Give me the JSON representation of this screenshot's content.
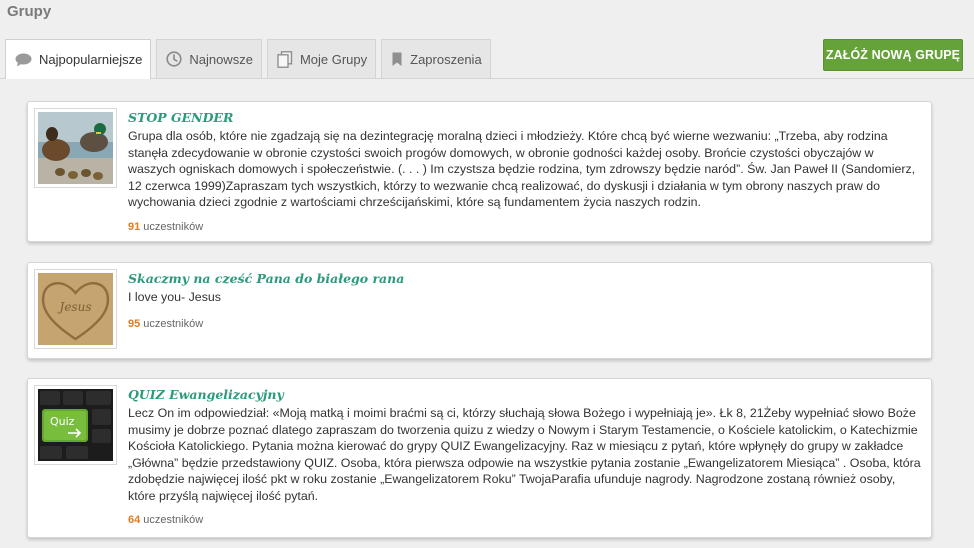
{
  "page": {
    "title": "Grupy"
  },
  "tabs": [
    {
      "label": "Najpopularniejsze",
      "icon": "speech-bubble-icon",
      "active": true
    },
    {
      "label": "Najnowsze",
      "icon": "clock-icon",
      "active": false
    },
    {
      "label": "Moje Grupy",
      "icon": "documents-icon",
      "active": false
    },
    {
      "label": "Zaproszenia",
      "icon": "bookmark-icon",
      "active": false
    }
  ],
  "create_button": {
    "label": "ZAŁÓŻ NOWĄ GRUPĘ"
  },
  "colors": {
    "accent_green": "#66a23a",
    "title_teal": "#2a9a7c",
    "count_orange": "#e07b22"
  },
  "groups": [
    {
      "title": "STOP GENDER",
      "description": "Grupa dla osób, które nie zgadzają się na dezintegrację moralną dzieci i młodzieży. Które chcą być wierne wezwaniu: „Trzeba, aby rodzina stanęła zdecydowanie w obronie czystości swoich progów domowych, w obronie godności każdej osoby. Brońcie czystości obyczajów w waszych ogniskach domowych i społeczeństwie. (. . . ) Im czystsza będzie rodzina, tym zdrowszy będzie naród”. Św. Jan Paweł II (Sandomierz, 12 czerwca 1999)Zapraszam tych wszystkich, którzy to wezwanie chcą realizować, do dyskusji i działania w tym obrony naszych praw do wychowania dzieci zgodnie z wartościami chrześcijańskimi, które są fundamentem życia naszych rodzin.",
      "count": "91",
      "count_label": "uczestników",
      "image": "ducks-photo"
    },
    {
      "title": "Skaczmy na cześć Pana do białego rana",
      "description": "I love you- Jesus",
      "count": "95",
      "count_label": "uczestników",
      "image": "jesus-heart-sand-photo"
    },
    {
      "title": "QUIZ Ewangelizacyjny",
      "description": "Lecz On im odpowiedział: «Moją matką i moimi braćmi są ci, którzy słuchają słowa Bożego i wypełniają je». Łk 8, 21Żeby wypełniać słowo Boże musimy je dobrze poznać dlatego zapraszam do tworzenia quizu z wiedzy o Nowym i Starym Testamencie, o Kościele katolickim, o Katechizmie Kościoła Katolickiego. Pytania można kierować do grypy QUIZ Ewangelizacyjny.  Raz w miesiącu z pytań, które wpłynęły do grupy w zakładce „Główna” będzie przedstawiony QUIZ. Osoba, która pierwsza odpowie na wszystkie pytania zostanie „Ewangelizatorem Miesiąca” . Osoba, która zdobędzie najwięcej ilość pkt w roku zostanie „Ewangelizatorem Roku” TwojaParafia ufunduje nagrody. Nagrodzone zostaną również osoby, które przyślą najwięcej ilość pytań.",
      "count": "64",
      "count_label": "uczestników",
      "image": "quiz-keyboard-photo",
      "image_text": "Quiz"
    }
  ]
}
